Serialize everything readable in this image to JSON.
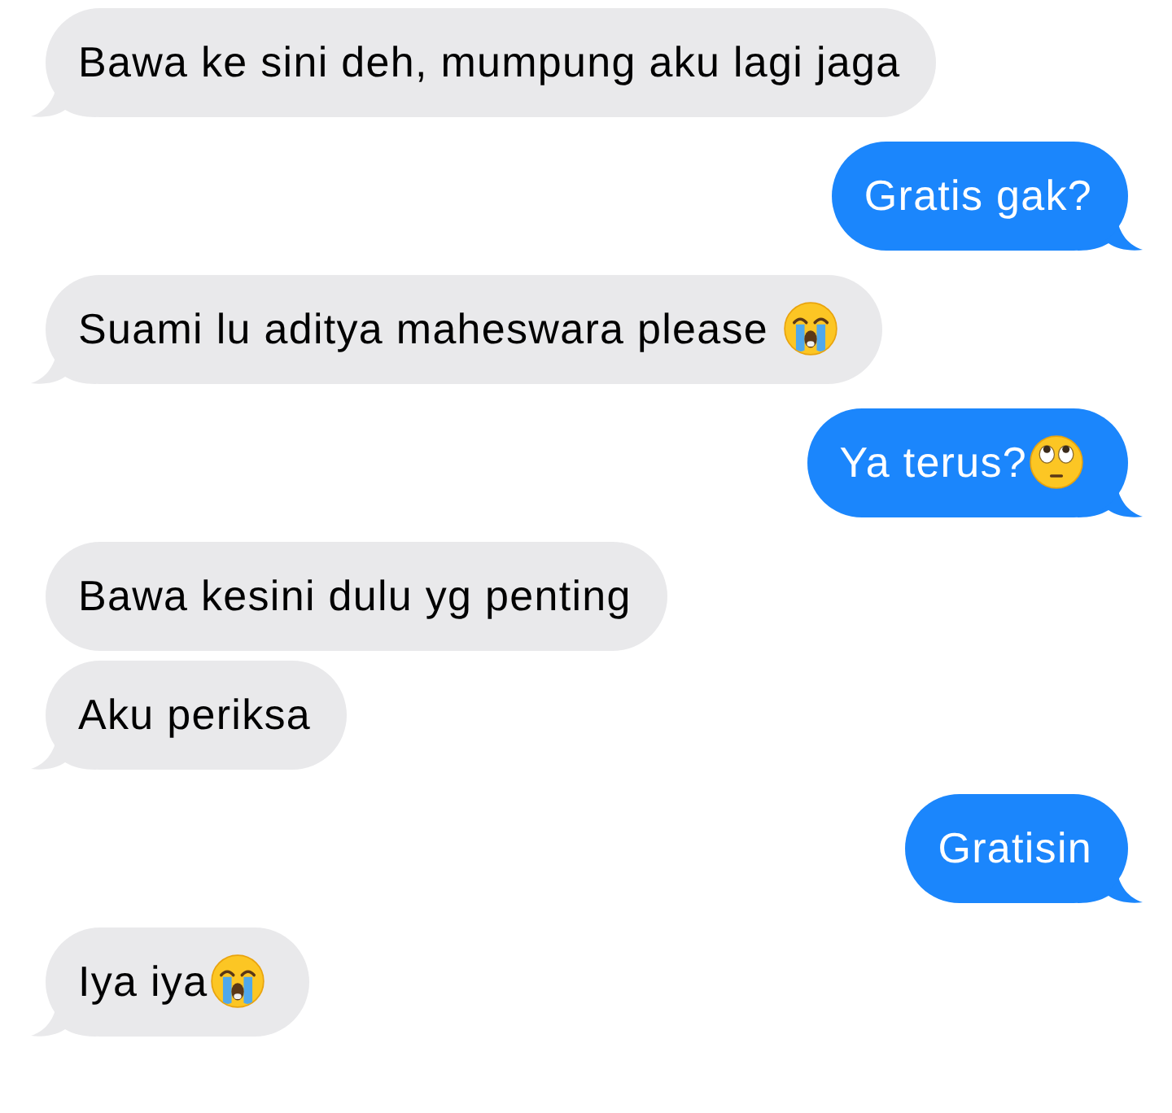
{
  "messages": [
    {
      "kind": "received",
      "text": "Bawa ke sini deh, mumpung aku lagi jaga",
      "tail": true
    },
    {
      "kind": "sent",
      "text": "Gratis gak?",
      "tail": true
    },
    {
      "kind": "received",
      "text": "Suami lu aditya maheswara please ",
      "emoji": {
        "kind": "crying"
      },
      "tail": true
    },
    {
      "kind": "sent",
      "text": "Ya terus?",
      "emoji": {
        "kind": "eye-roll"
      },
      "tail": true
    },
    {
      "kind": "received",
      "text": "Bawa kesini dulu yg penting",
      "tail": false
    },
    {
      "kind": "received",
      "text": "Aku periksa",
      "tail": true
    },
    {
      "kind": "sent",
      "text": "Gratisin",
      "tail": true
    },
    {
      "kind": "received",
      "text": "Iya iya",
      "emoji": {
        "kind": "crying"
      },
      "tail": true
    }
  ]
}
